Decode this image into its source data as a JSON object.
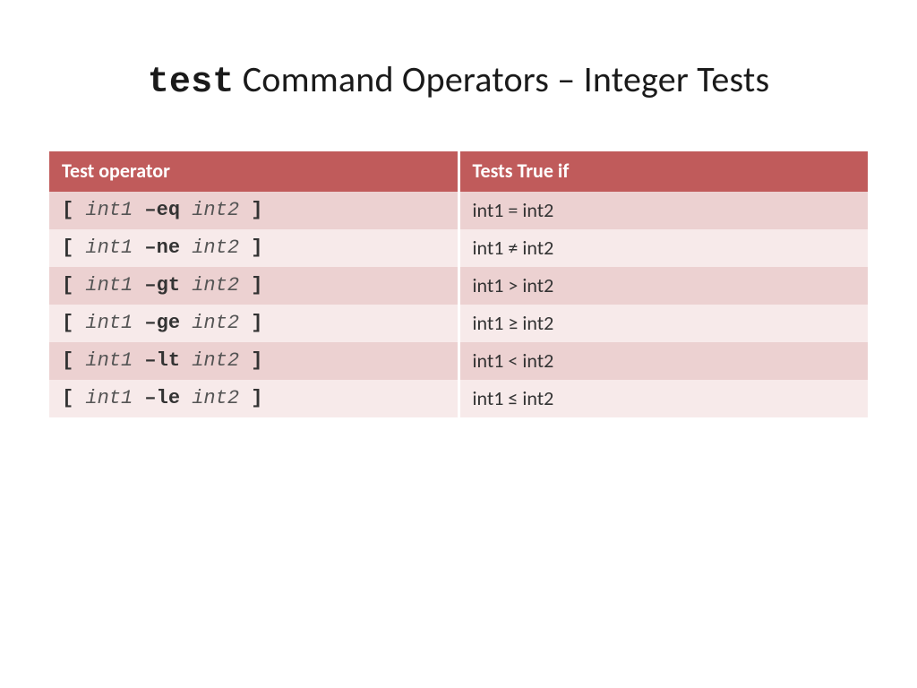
{
  "title_mono": "test",
  "title_rest": " Command Operators – Integer Tests",
  "headers": {
    "col1": "Test operator",
    "col2": "Tests True if"
  },
  "rows": [
    {
      "lb": "[ ",
      "a1": "int1",
      "op": " –eq ",
      "a2": "int2",
      "rb": " ]",
      "desc": "int1 = int2"
    },
    {
      "lb": "[ ",
      "a1": "int1",
      "op": " –ne ",
      "a2": "int2",
      "rb": " ]",
      "desc": "int1 ≠ int2"
    },
    {
      "lb": "[ ",
      "a1": "int1",
      "op": " –gt ",
      "a2": "int2",
      "rb": " ]",
      "desc": "int1 > int2"
    },
    {
      "lb": "[ ",
      "a1": "int1",
      "op": " –ge ",
      "a2": "int2",
      "rb": " ]",
      "desc": "int1 ≥ int2"
    },
    {
      "lb": "[ ",
      "a1": "int1",
      "op": " –lt ",
      "a2": "int2",
      "rb": " ]",
      "desc": "int1 < int2"
    },
    {
      "lb": "[ ",
      "a1": "int1",
      "op": " –le ",
      "a2": "int2",
      "rb": " ]",
      "desc": "int1 ≤ int2"
    }
  ]
}
